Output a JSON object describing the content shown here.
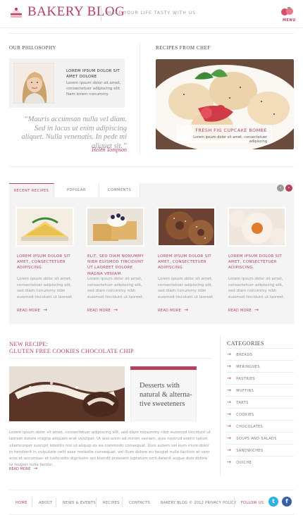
{
  "header": {
    "logo_text": "BAKERY BLOG",
    "tagline": "MAKE YOUR LIFE TASTY WITH US",
    "menu_label": "MENU"
  },
  "philosophy": {
    "title": "OUR PHILOSOPHY",
    "heading": "LOREM IPSUM DOLOR SIT AMET DOLORE",
    "body": "Lorem ipsum dolor sit amet, consectetuer adipiscing elit. Nam lorem nonummy",
    "quote": "“Mauris accumsan nulla vel diam. Sed in lacus ut enim adipiscing aliquet. Nulla venenatis. In pede mi aliquet sit.”",
    "author": "Helen Tompson"
  },
  "recipes_from_chef": {
    "title": "RECIPES FROM CHEF",
    "caption_title": "FRESH FIG CUPCAKE BOMBE",
    "caption_text": "Lorem ipsum dolor sit amet, consectetuer adipiscing"
  },
  "tabs": {
    "items": [
      {
        "label": "RECENT RECIPES",
        "active": true
      },
      {
        "label": "POPULAR",
        "active": false
      },
      {
        "label": "COMMENTS",
        "active": false
      }
    ],
    "prev_icon": "chevron-left-icon",
    "next_icon": "chevron-right-icon"
  },
  "cards": [
    {
      "title": "LOREM IPSUM DOLOR SIT AMET, CONSECTETUER ADIPISCING.",
      "text": "Lorem ipsum dolor sit amet, consectetuer adipiscing elit, sed diam nonummy nibh euismod tincidunt ut laoreet.",
      "more": "READ MORE"
    },
    {
      "title": "ELIT, SED DIAM NONUMMY NIBH EUISMOD TINCIDUNT UT LAOREET DOLORE MAGNA VENIAM.",
      "text": "Lorem ipsum dolor sit amet, consectetuer adipiscing elit, sed diam nonummy nibh euismod tincidunt ut laoreet.",
      "more": "READ MORE"
    },
    {
      "title": "LOREM IPSUM DOLOR SIT AMET, CONSECTETUER ADIPISCING.",
      "text": "Lorem ipsum dolor sit amet, consectetuer adipiscing elit, sed diam nonummy nibh euismod tincidunt ut laoreet.",
      "more": "READ MORE"
    },
    {
      "title": "LOREM IPSUM DOLOR SIT AMET, CONSECTETUER ADIPISCING.",
      "text": "Lorem ipsum dolor sit amet, consectetuer adipiscing elit, sed diam nonummy nibh euismod tincidunt ut laoreet.",
      "more": "READ MORE"
    }
  ],
  "new_recipe": {
    "title_line1": "NEW RECIPE:",
    "title_line2": "GLUTEN FREE COOKIES CHOCOLATE CHIP",
    "box_text": "Desserts with natural & alterna- tive sweeteners",
    "body": "Lorem ipsum dolor sit amet, consectetuer adipiscing elit, sed diam nonummy nibh euismod tincidunt ut laoreet dolore magna aliquam erat volutpat. Ut wisi enim ad minim veniam, quis nostrud exerci tation ullamcorper suscipit lobortis nisl ut aliquip ex ea commodo consequat. Duis autem vel eum iriure dolor in hendrerit in vulputate velit esse molestie consequat, vel illum dolore eu feugiat nulla facilisis at vero eros et accumsan et iusto odio dignissim qui blandit praesent luptatum zzril delenit augue duis dolore te feugait nulla facilisi.",
    "more": "READ MORE"
  },
  "categories": {
    "title": "CATEGORIES",
    "items": [
      "BREADS",
      "MERINGUES",
      "PASTRIES",
      "MUFFINS",
      "TARTS",
      "COOKIES",
      "CHOCOLATES",
      "SOUPS AND SALADS",
      "SANDWICHES",
      "QUICHE"
    ]
  },
  "footer": {
    "nav": [
      "HOME",
      "ABOUT",
      "NEWS & EVENTS",
      "RECIPES",
      "CONTACTS"
    ],
    "copyright": "BAKERY BLOG © 2012 PRIVACY POLICY",
    "follow": "FOLLOW US",
    "social_icons": [
      "twitter-icon",
      "facebook-icon"
    ]
  },
  "colors": {
    "accent": "#b4425c",
    "twitter": "#2fb0e6",
    "facebook": "#3b5fa6",
    "tab_nav": "#9a9a9a"
  }
}
